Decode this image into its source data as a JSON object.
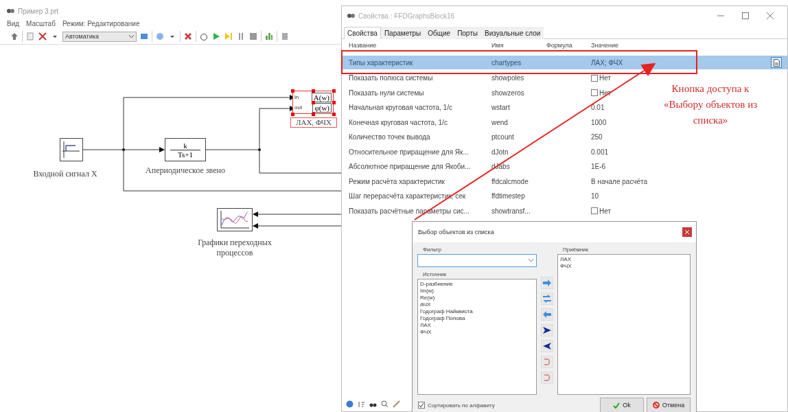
{
  "app": {
    "title": "Пример 3.prt",
    "menu": [
      "Вид",
      "Масштаб",
      "Режим: Редактирование"
    ],
    "toolbar": {
      "mode": "Автоматика"
    }
  },
  "diagram": {
    "blocks": [
      {
        "kind": "step",
        "label": "Входной сигнал X"
      },
      {
        "kind": "transfer",
        "numerator": "k",
        "denominator": "Ts+1",
        "label": "Апериодическое звено"
      },
      {
        "kind": "ffd",
        "selected": true,
        "ports": [
          {
            "port": "in",
            "output": "A(w)"
          },
          {
            "port": "out",
            "output": "φ(w)"
          }
        ],
        "label": "ЛАХ, ФЧХ"
      },
      {
        "kind": "plot",
        "label": "Графики переходных процессов"
      }
    ]
  },
  "properties_window": {
    "title": "Свойства : FFDGraphsBlock16",
    "tabs": [
      {
        "label": "Свойства",
        "selected": true
      },
      {
        "label": "Параметры",
        "selected": false
      },
      {
        "label": "Общие",
        "selected": false
      },
      {
        "label": "Порты",
        "selected": false
      },
      {
        "label": "Визуальные слои",
        "selected": false
      }
    ],
    "columns": [
      "Название",
      "Имя",
      "Формула",
      "Значение"
    ],
    "rows": [
      {
        "name": "Типы характеристик",
        "id": "chartypes",
        "kind": "list",
        "value": "ЛАХ; ФЧХ",
        "selected": true
      },
      {
        "name": "Показать полюса системы",
        "id": "showpoles",
        "kind": "checkbox",
        "value": "Нет",
        "checked": false,
        "selected": false
      },
      {
        "name": "Показать нули системы",
        "id": "showzeros",
        "kind": "checkbox",
        "value": "Нет",
        "checked": false,
        "selected": false
      },
      {
        "name": "Начальная круговая частота, 1/с",
        "id": "wstart",
        "kind": "text",
        "value": "0.01",
        "selected": false
      },
      {
        "name": "Конечная круговая частота, 1/с",
        "id": "wend",
        "kind": "text",
        "value": "1000",
        "selected": false
      },
      {
        "name": "Количество точек вывода",
        "id": "ptcount",
        "kind": "text",
        "value": "250",
        "selected": false
      },
      {
        "name": "Относительное приращение для Як...",
        "id": "dJotn",
        "kind": "text",
        "value": "0.001",
        "selected": false
      },
      {
        "name": "Абсолютное приращение для Якоби...",
        "id": "dJabs",
        "kind": "text",
        "value": "1E-6",
        "selected": false
      },
      {
        "name": "Режим расчёта характеристик",
        "id": "ffdcalcmode",
        "kind": "text",
        "value": "В начале расчёта",
        "selected": false
      },
      {
        "name": "Шаг перерасчёта характеристик, сек",
        "id": "ffdtimestep",
        "kind": "text",
        "value": "10",
        "selected": false
      },
      {
        "name": "Показать расчётные параметры сис...",
        "id": "showtransf...",
        "kind": "checkbox",
        "value": "Нет",
        "checked": false,
        "selected": false
      }
    ]
  },
  "dialog": {
    "title": "Выбор объектов из списка",
    "filter_label": "Фильтр",
    "source_label": "Источник",
    "source": [
      "D-разбиение",
      "Im(w)",
      "Re(w)",
      "АЧХ",
      "Годограф Найквиста",
      "Годограф Попова",
      "ЛАХ",
      "ФЧХ"
    ],
    "receiver_label": "Приёмник",
    "receiver": [
      "ЛАХ",
      "ФЧХ"
    ],
    "sort": {
      "label": "Сортировать по алфавиту",
      "checked": true
    },
    "buttons": [
      {
        "kind": "ok",
        "label": "Ok"
      },
      {
        "kind": "cancel",
        "label": "Отмена"
      }
    ]
  },
  "annotation": {
    "text": "Кнопка доступа к «Выбору объектов из списка»"
  }
}
